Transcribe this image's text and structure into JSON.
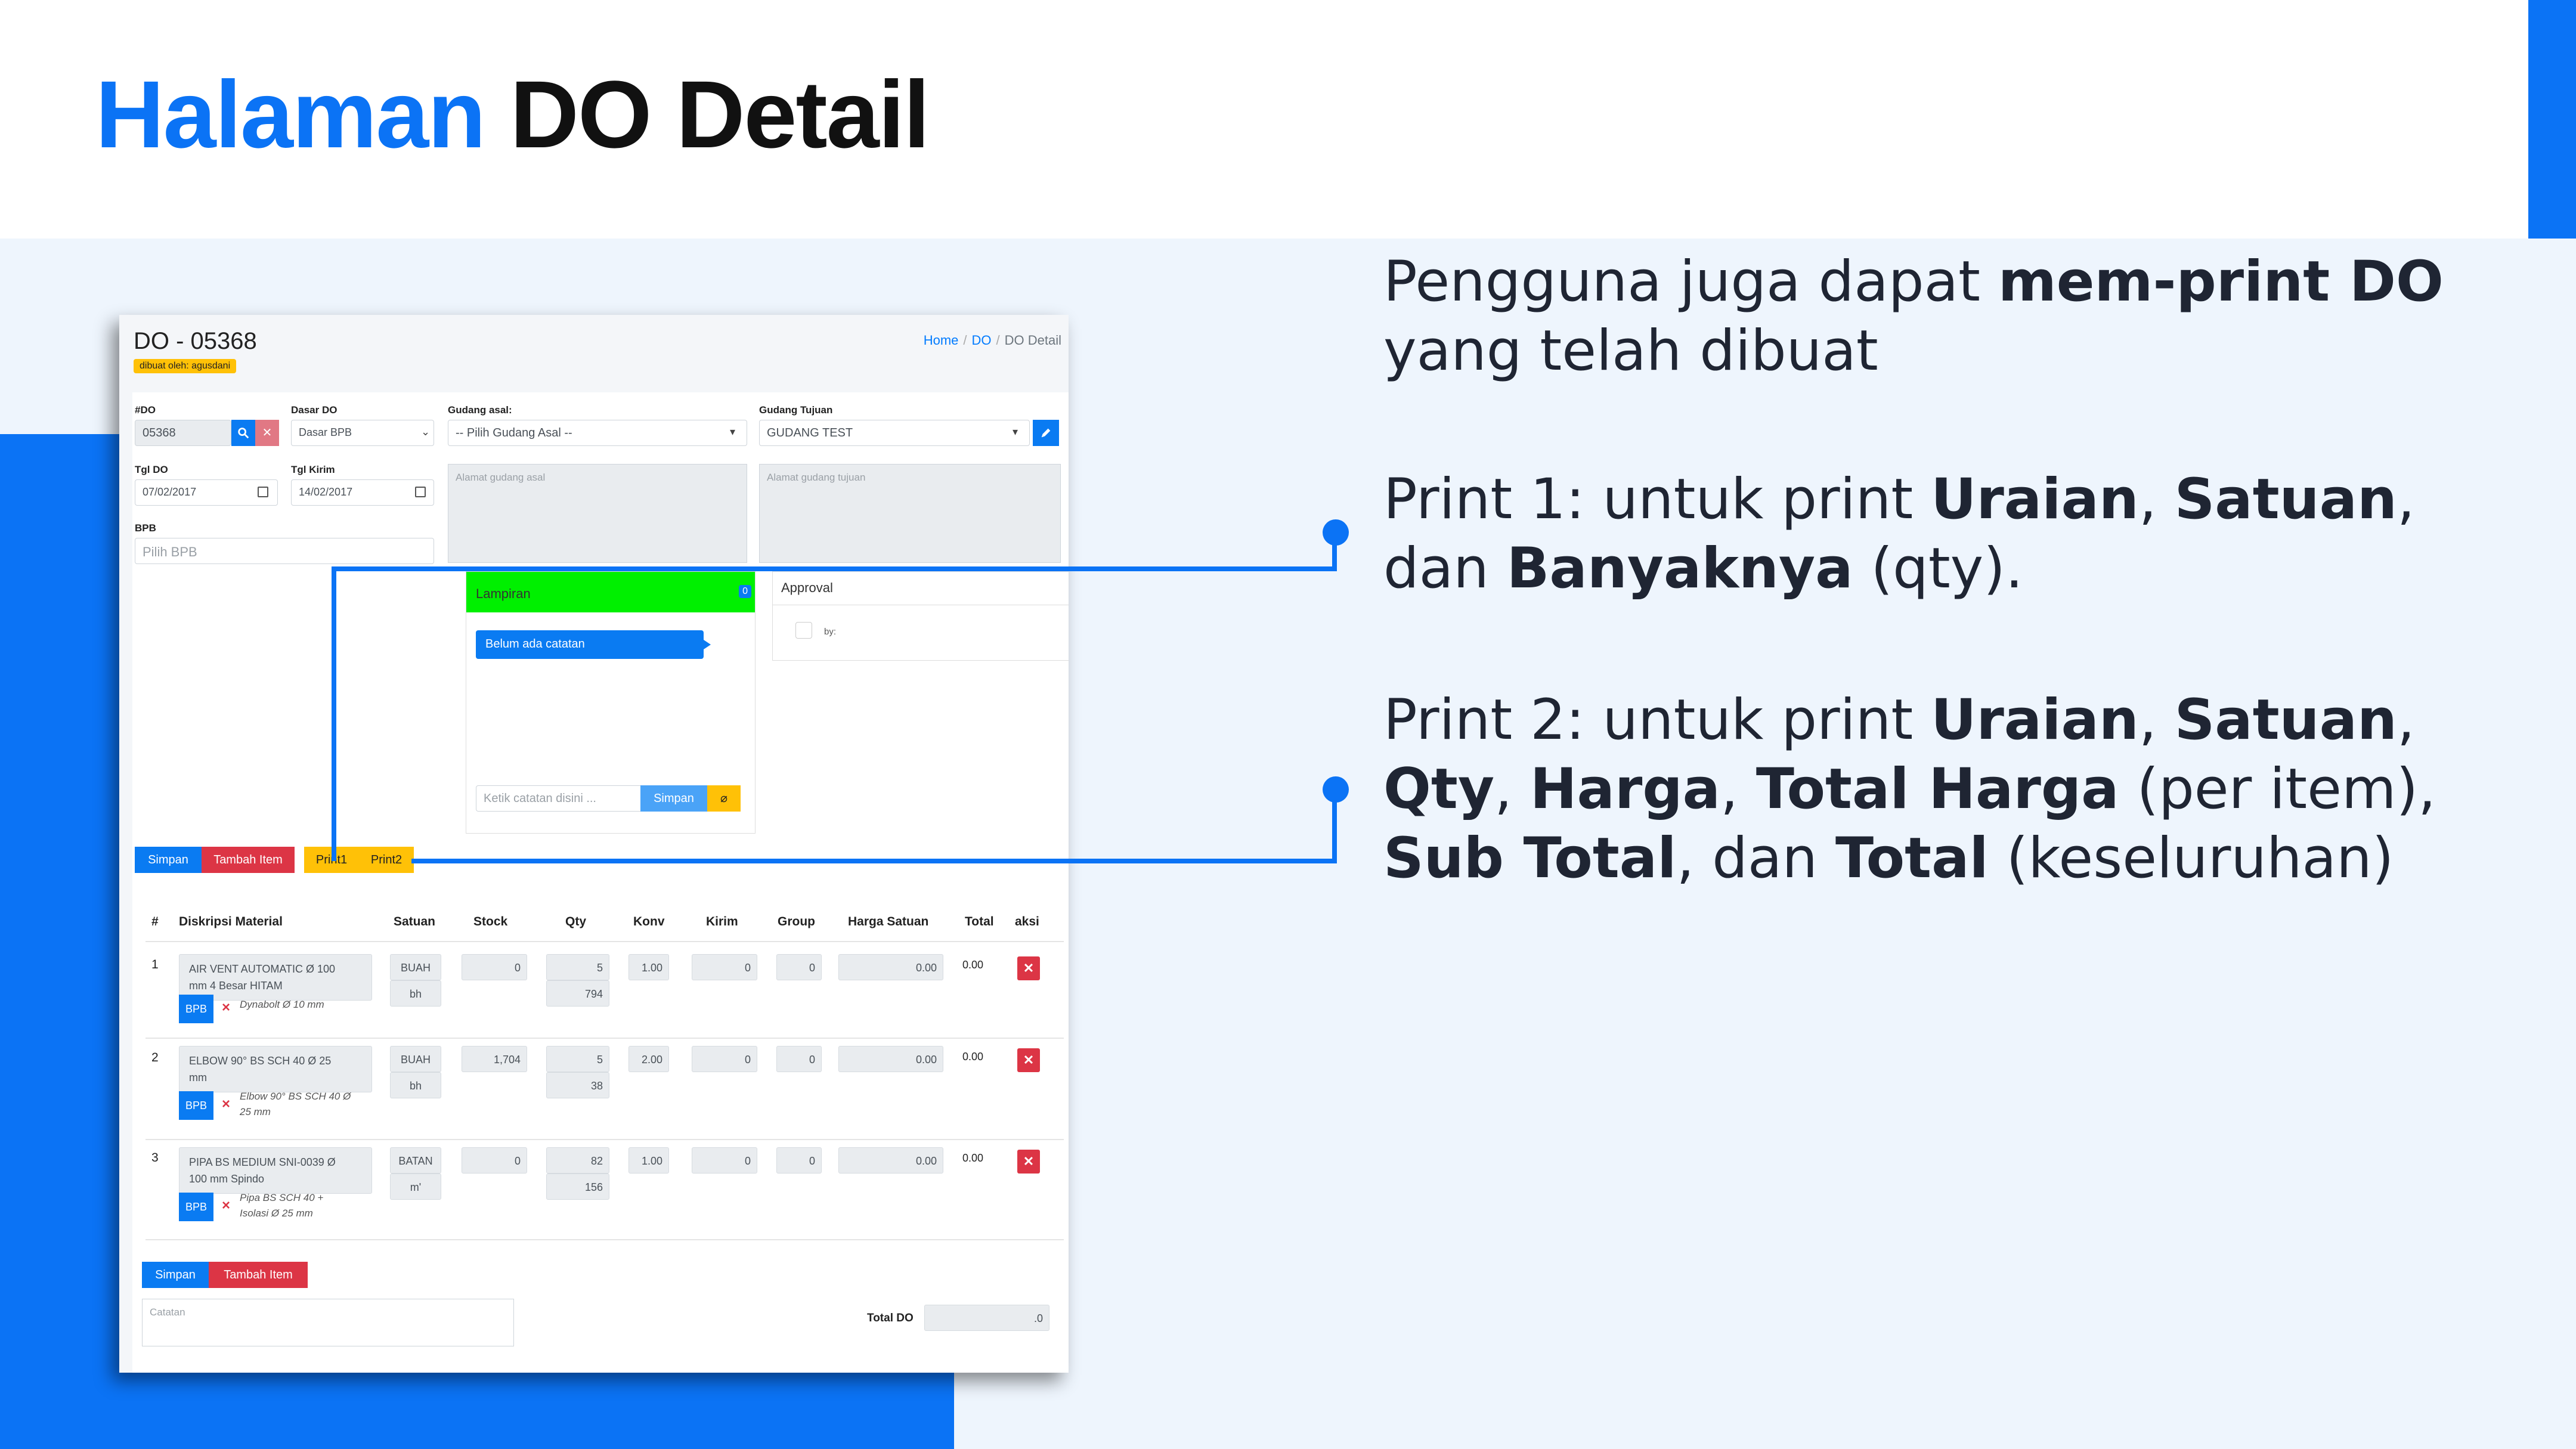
{
  "slide": {
    "title_accent": "Halaman",
    "title_rest": "DO Detail",
    "desc1": {
      "p1": "Pengguna juga dapat ",
      "b1": "mem-print DO",
      "p2": " yang telah dibuat"
    },
    "desc2": {
      "p1": "Print 1: untuk print ",
      "b1": "Uraian",
      "p2": ", ",
      "b2": "Satuan",
      "p3": ", dan ",
      "b3": "Banyaknya",
      "p4": " (qty)."
    },
    "desc3": {
      "p1": "Print 2: untuk print ",
      "b1": "Uraian",
      "p2": ", ",
      "b2": "Satuan",
      "p3": ", ",
      "b3": "Qty",
      "p4": ", ",
      "b4": "Harga",
      "p5": ", ",
      "b5": "Total Harga",
      "p6": " (per item), ",
      "b6": "Sub Total",
      "p7": ", dan ",
      "b7": "Total",
      "p8": " (keseluruhan)"
    },
    "colors": {
      "accent": "#0b73f5",
      "light_bg": "#eef5fd"
    }
  },
  "app": {
    "title": "DO - 05368",
    "creator": "dibuat oleh: agusdani",
    "breadcrumb": {
      "home": "Home",
      "do": "DO",
      "current": "DO Detail",
      "sep": "/"
    },
    "form": {
      "do_label": "#DO",
      "do_value": "05368",
      "dasar_label": "Dasar DO",
      "dasar_value": "Dasar BPB",
      "gudang_asal_label": "Gudang asal:",
      "gudang_asal_value": "-- Pilih Gudang Asal --",
      "gudang_tujuan_label": "Gudang Tujuan",
      "gudang_tujuan_value": "GUDANG TEST",
      "tgl_do_label": "Tgl DO",
      "tgl_do_value": "07/02/2017",
      "tgl_kirim_label": "Tgl Kirim",
      "tgl_kirim_value": "14/02/2017",
      "alamat_asal_placeholder": "Alamat gudang asal",
      "alamat_tujuan_placeholder": "Alamat gudang tujuan",
      "bpb_label": "BPB",
      "bpb_placeholder": "Pilih BPB"
    },
    "lampiran": {
      "title": "Lampiran",
      "count": "0",
      "bubble": "Belum ada catatan",
      "input_placeholder": "Ketik catatan disini ...",
      "send_label": "Simpan"
    },
    "approval": {
      "title": "Approval",
      "by": "by:"
    },
    "actions": {
      "simpan": "Simpan",
      "tambah": "Tambah Item",
      "print1": "Print1",
      "print2": "Print2"
    },
    "table": {
      "headers": [
        "#",
        "Diskripsi Material",
        "Satuan",
        "Stock",
        "Qty",
        "Konv",
        "Kirim",
        "Group",
        "Harga Satuan",
        "Total",
        "aksi"
      ],
      "rows": [
        {
          "no": "1",
          "desc_l1": "AIR VENT AUTOMATIC   Ø 100",
          "desc_l2": "mm  4 Besar HITAM",
          "bpb": "BPB",
          "note_l1": "Dynabolt Ø 10 mm",
          "note_l2": "",
          "satuan": "BUAH",
          "satuan2": "bh",
          "stock": "0",
          "qty": "5",
          "qty2": "794",
          "konv": "1.00",
          "kirim": "0",
          "group": "0",
          "harga": "0.00",
          "total": "0.00"
        },
        {
          "no": "2",
          "desc_l1": "ELBOW 90° BS SCH 40 Ø 25",
          "desc_l2": "mm",
          "bpb": "BPB",
          "note_l1": "Elbow 90° BS SCH 40 Ø",
          "note_l2": "25 mm",
          "satuan": "BUAH",
          "satuan2": "bh",
          "stock": "1,704",
          "qty": "5",
          "qty2": "38",
          "konv": "2.00",
          "kirim": "0",
          "group": "0",
          "harga": "0.00",
          "total": "0.00"
        },
        {
          "no": "3",
          "desc_l1": "PIPA BS MEDIUM SNI-0039 Ø",
          "desc_l2": "100 mm  Spindo",
          "bpb": "BPB",
          "note_l1": "Pipa BS SCH 40 +",
          "note_l2": "Isolasi Ø 25 mm",
          "satuan": "BATAN",
          "satuan2": "m'",
          "stock": "0",
          "qty": "82",
          "qty2": "156",
          "konv": "1.00",
          "kirim": "0",
          "group": "0",
          "harga": "0.00",
          "total": "0.00"
        }
      ]
    },
    "footer": {
      "simpan": "Simpan",
      "tambah": "Tambah Item",
      "catatan_placeholder": "Catatan",
      "total_label": "Total DO",
      "total_value": ".0"
    }
  }
}
